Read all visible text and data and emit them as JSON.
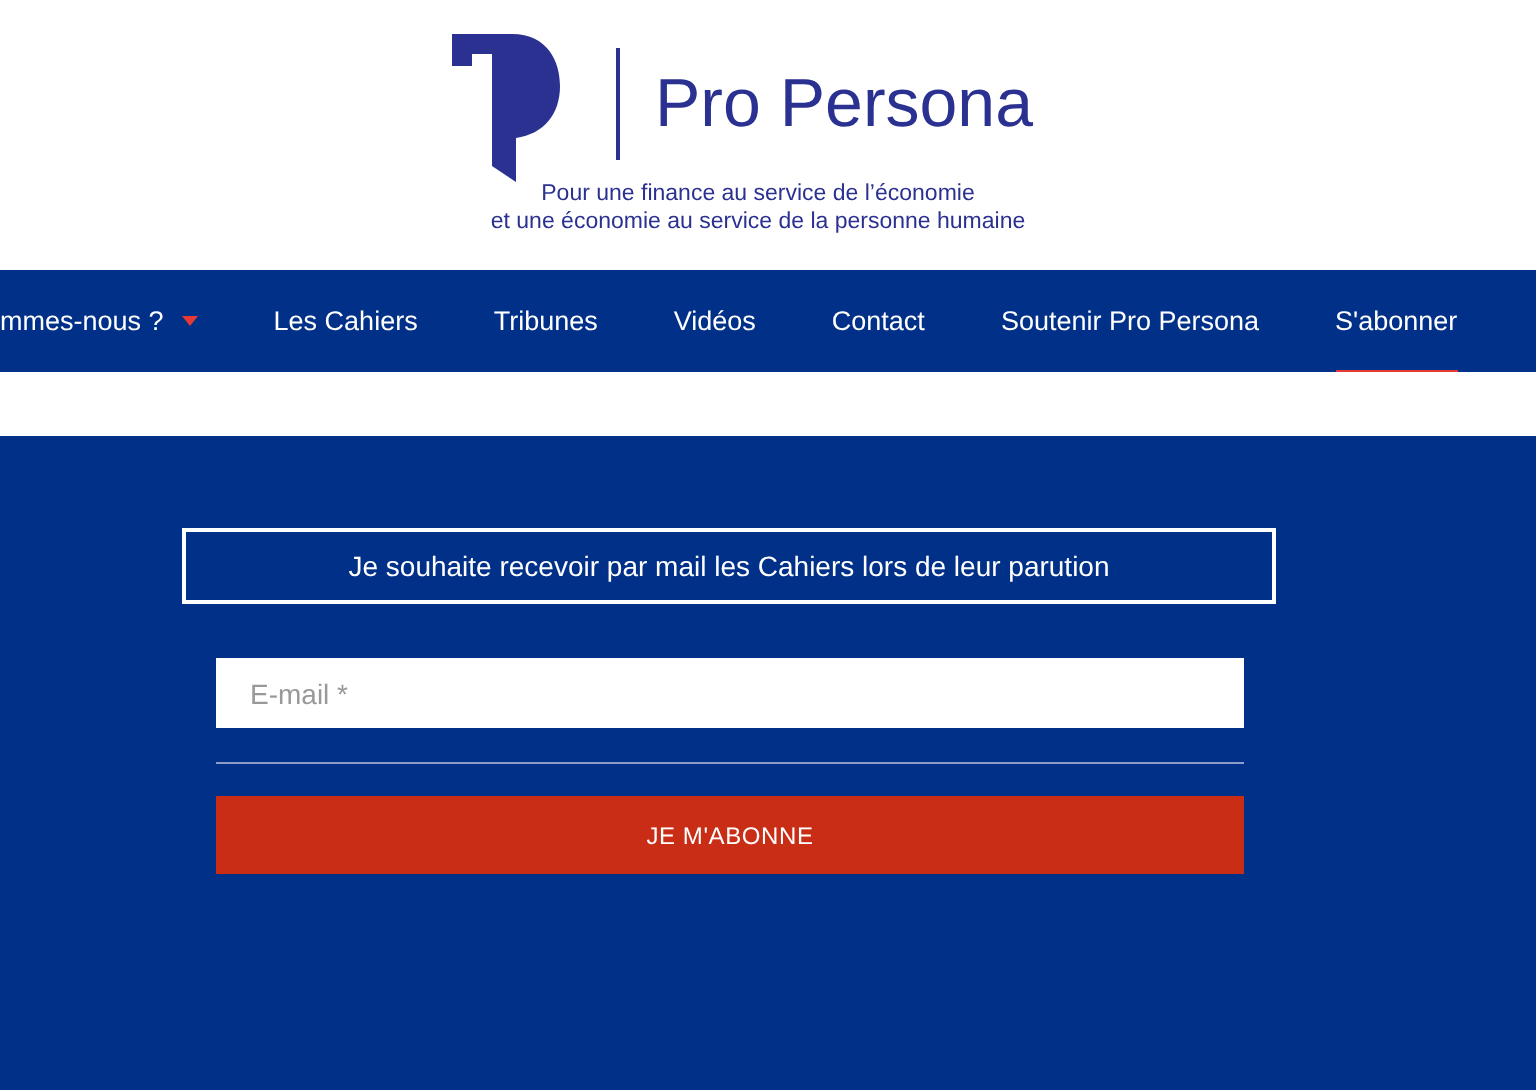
{
  "header": {
    "brand": "Pro Persona",
    "tagline": [
      "Pour une finance au service de l’économie",
      "et une économie au service de la personne humaine"
    ]
  },
  "nav": [
    {
      "label": "mmes-nous ?",
      "dropdown": true,
      "selected": false
    },
    {
      "label": "Les Cahiers",
      "dropdown": false,
      "selected": false
    },
    {
      "label": "Tribunes",
      "dropdown": false,
      "selected": false
    },
    {
      "label": "Vidéos",
      "dropdown": false,
      "selected": false
    },
    {
      "label": "Contact",
      "dropdown": false,
      "selected": false
    },
    {
      "label": "Soutenir Pro Persona",
      "dropdown": false,
      "selected": false
    },
    {
      "label": "S'abonner",
      "dropdown": false,
      "selected": true
    }
  ],
  "subscribe": {
    "heading": "Je souhaite recevoir par mail les Cahiers lors de leur parution",
    "email": {
      "placeholder": "E-mail *"
    },
    "button": "JE M'ABONNE"
  }
}
